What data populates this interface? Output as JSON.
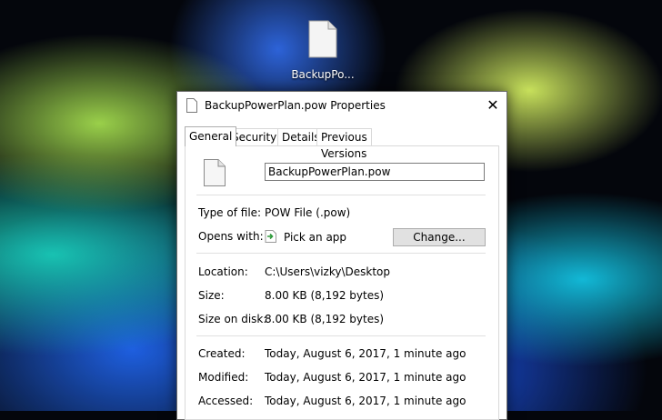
{
  "desktop": {
    "icon_label": "BackupPo..."
  },
  "dialog": {
    "title": "BackupPowerPlan.pow Properties",
    "close_glyph": "✕",
    "tabs": [
      {
        "label": "General"
      },
      {
        "label": "Security"
      },
      {
        "label": "Details"
      },
      {
        "label": "Previous Versions"
      }
    ],
    "file_name": "BackupPowerPlan.pow",
    "type_of_file": {
      "label": "Type of file:",
      "value": "POW File (.pow)"
    },
    "opens_with": {
      "label": "Opens with:",
      "value": "Pick an app",
      "button": "Change..."
    },
    "location": {
      "label": "Location:",
      "value": "C:\\Users\\vizky\\Desktop"
    },
    "size": {
      "label": "Size:",
      "value": "8.00 KB (8,192 bytes)"
    },
    "size_on_disk": {
      "label": "Size on disk:",
      "value": "8.00 KB (8,192 bytes)"
    },
    "created": {
      "label": "Created:",
      "value": "Today, August 6, 2017, 1 minute ago"
    },
    "modified": {
      "label": "Modified:",
      "value": "Today, August 6, 2017, 1 minute ago"
    },
    "accessed": {
      "label": "Accessed:",
      "value": "Today, August 6, 2017, 1 minute ago"
    }
  },
  "colors": {
    "dialog_bg": "#ffffff",
    "button_bg": "#e1e1e1",
    "app_icon_green": "#2e9a3a"
  }
}
